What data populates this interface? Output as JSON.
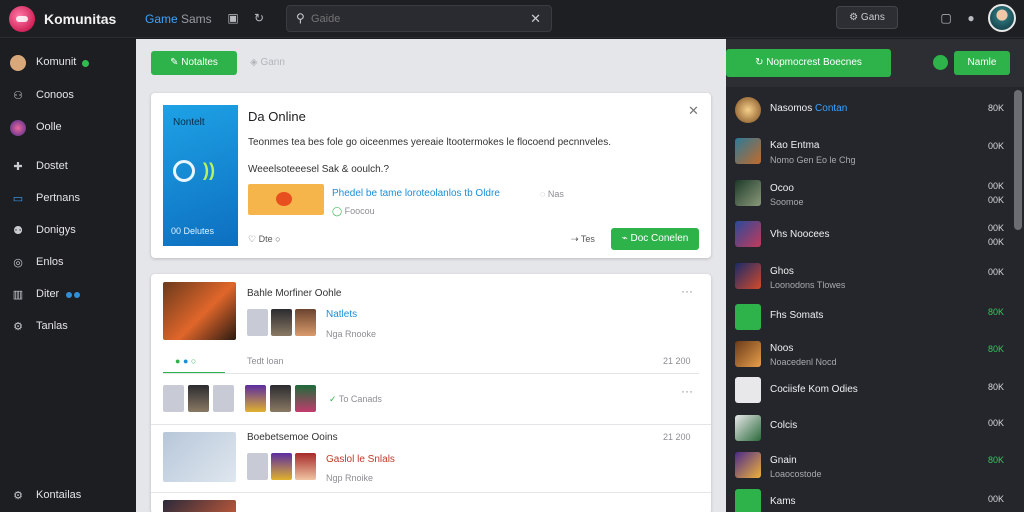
{
  "header": {
    "app_title": "Komunitas",
    "nav": [
      "Game",
      "Sams"
    ],
    "search_placeholder": "Gaide",
    "top_button": "Gans"
  },
  "sidebar": {
    "items": [
      {
        "label": "Komunit",
        "icon": "user-avatar-icon"
      },
      {
        "label": "Conoos",
        "icon": "people-icon"
      },
      {
        "label": "Oolle",
        "icon": "circle-avatar-icon"
      },
      {
        "label": "Dostet",
        "icon": "gamepad-icon"
      },
      {
        "label": "Pertnans",
        "icon": "monitor-icon"
      },
      {
        "label": "Donigys",
        "icon": "users-icon"
      },
      {
        "label": "Enlos",
        "icon": "compass-icon"
      },
      {
        "label": "Diter",
        "icon": "chart-icon"
      },
      {
        "label": "Tanlas",
        "icon": "gear-icon"
      }
    ],
    "footer_label": "Kontailas"
  },
  "main": {
    "new_button": "Notaltes",
    "ghost_button": "Gann",
    "promo": {
      "image_title": "Nontelt",
      "image_footer": "00 Delutes",
      "title": "Da Online",
      "text1": "Teonmes tea bes fole go oiceenmes yereaie ltootermokes le flocoend pecnnveles.",
      "text2": "Weeelsoteeesel Sak & ooulch.?",
      "link": "Phedel be tame loroteolanlos tb Oldre",
      "meta": "Nas",
      "sub": "Foocou",
      "footer_left": "Dte",
      "footer_mid": "Tes",
      "action_button": "Doc Conelen"
    },
    "feed": {
      "post1": {
        "title": "Bahle Morfiner Oohle",
        "link": "Natlets",
        "sub": "Nga Rnooke",
        "more": "···"
      },
      "tabs": {
        "label": "Tedt loan",
        "count": "21 200"
      },
      "post2": {
        "tag": "To Canads",
        "more": "···"
      },
      "post3": {
        "title": "Boebetsemoe Ooins",
        "count": "21 200",
        "link": "Gaslol le Snlals",
        "sub": "Ngp Rnoike"
      }
    }
  },
  "right": {
    "header_button": "Nopmocrest Boecnes",
    "header_button2": "Namle",
    "items": [
      {
        "label": "Nasomos",
        "label2": "Contan",
        "sub": "",
        "value": "80K",
        "green": false
      },
      {
        "label": "Kao Entma",
        "label2": "",
        "sub": "Nomo Gen Eo le Chg",
        "value": "00K",
        "green": false
      },
      {
        "label": "Ocoo",
        "label2": "",
        "sub": "Soomoe",
        "value": "00K",
        "green": false
      },
      {
        "label": "Vhs Noocees",
        "label2": "",
        "sub": "",
        "value": "00K",
        "green": false
      },
      {
        "label": "Ghos",
        "label2": "",
        "sub": "Loonodons Tlowes",
        "value": "00K",
        "green": false
      },
      {
        "label": "Fhs Somats",
        "label2": "",
        "sub": "",
        "value": "80K",
        "green": true
      },
      {
        "label": "Noos",
        "label2": "",
        "sub": "Noacedenl Nocd",
        "value": "80K",
        "green": true
      },
      {
        "label": "Cociisfe Kom Odies",
        "label2": "",
        "sub": "",
        "value": "80K",
        "green": false
      },
      {
        "label": "Colcis",
        "label2": "",
        "sub": "",
        "value": "00K",
        "green": false
      },
      {
        "label": "Gnain",
        "label2": "",
        "sub": "Loaocostode",
        "value": "80K",
        "green": true
      },
      {
        "label": "Kams",
        "label2": "",
        "sub": "",
        "value": "00K",
        "green": false
      }
    ]
  },
  "colors": {
    "accent_green": "#2eb34a",
    "link_blue": "#1a8fd8",
    "bg_dark": "#1b1c20"
  }
}
